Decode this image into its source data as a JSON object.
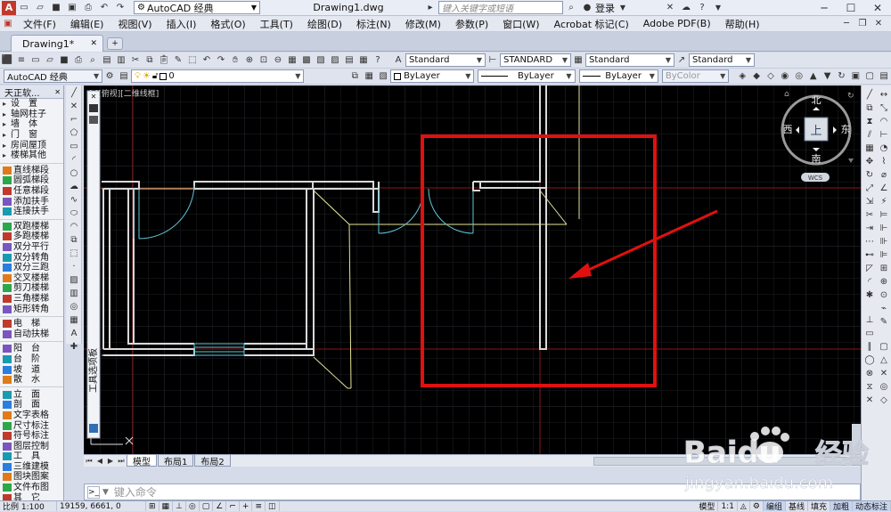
{
  "titlebar": {
    "workspace": "AutoCAD 经典",
    "doc_title": "Drawing1.dwg",
    "search_placeholder": "键入关键字或短语",
    "login": "登录"
  },
  "menu": [
    "文件(F)",
    "编辑(E)",
    "视图(V)",
    "插入(I)",
    "格式(O)",
    "工具(T)",
    "绘图(D)",
    "标注(N)",
    "修改(M)",
    "参数(P)",
    "窗口(W)",
    "Acrobat 标记(C)",
    "Adobe PDF(B)",
    "帮助(H)"
  ],
  "doc_tab": "Drawing1*",
  "styles": {
    "text_style": "Standard",
    "dim_style": "STANDARD",
    "table_style": "Standard",
    "mleader_style": "Standard"
  },
  "layer_bar": {
    "workspace": "AutoCAD 经典",
    "layer": "0",
    "color": "ByLayer",
    "linetype": "ByLayer",
    "lineweight": "ByLayer",
    "plotstyle": "ByColor"
  },
  "left_panel": {
    "title": "天正软...",
    "groups": [
      [
        "设　置",
        "轴网柱子",
        "墙　体",
        "门　窗",
        "房间屋顶",
        "楼梯其他"
      ],
      [
        "直线梯段",
        "圆弧梯段",
        "任意梯段",
        "添加扶手",
        "连接扶手"
      ],
      [
        "双跑楼梯",
        "多跑楼梯",
        "双分平行",
        "双分转角",
        "双分三跑",
        "交叉楼梯",
        "剪刀楼梯",
        "三角楼梯",
        "矩形转角"
      ],
      [
        "电　梯",
        "自动扶梯"
      ],
      [
        "阳　台",
        "台　阶",
        "坡　道",
        "散　水"
      ],
      [
        "立　面",
        "剖　面",
        "文字表格",
        "尺寸标注",
        "符号标注",
        "图层控制",
        "工　具",
        "三维建模",
        "图块图案",
        "文件布图",
        "其　它"
      ]
    ]
  },
  "viewport_label": "[-][俯视][二维线框]",
  "viewcube": {
    "north": "北",
    "south": "南",
    "east": "东",
    "west": "西",
    "top": "上",
    "wcs": "WCS"
  },
  "palette_label": "工具选项板",
  "layout_tabs": [
    "模型",
    "布局1",
    "布局2"
  ],
  "command_placeholder": "键入命令",
  "status": {
    "scale": "比例 1:100",
    "coords": "19159, 6661, 0",
    "model": "模型",
    "anno_scale": "1:1",
    "toggles": [
      "编组",
      "基线",
      "填充",
      "加粗",
      "动态标注"
    ]
  },
  "watermark": {
    "brand": "Baidu",
    "cn": "经验",
    "url": "jingyan.baidu.com"
  },
  "colors": {
    "highlight_box": "#e01010",
    "arrow": "#e01010",
    "wall": "#d9d9d9",
    "door": "#5fc9d8",
    "axis": "#a01818"
  }
}
